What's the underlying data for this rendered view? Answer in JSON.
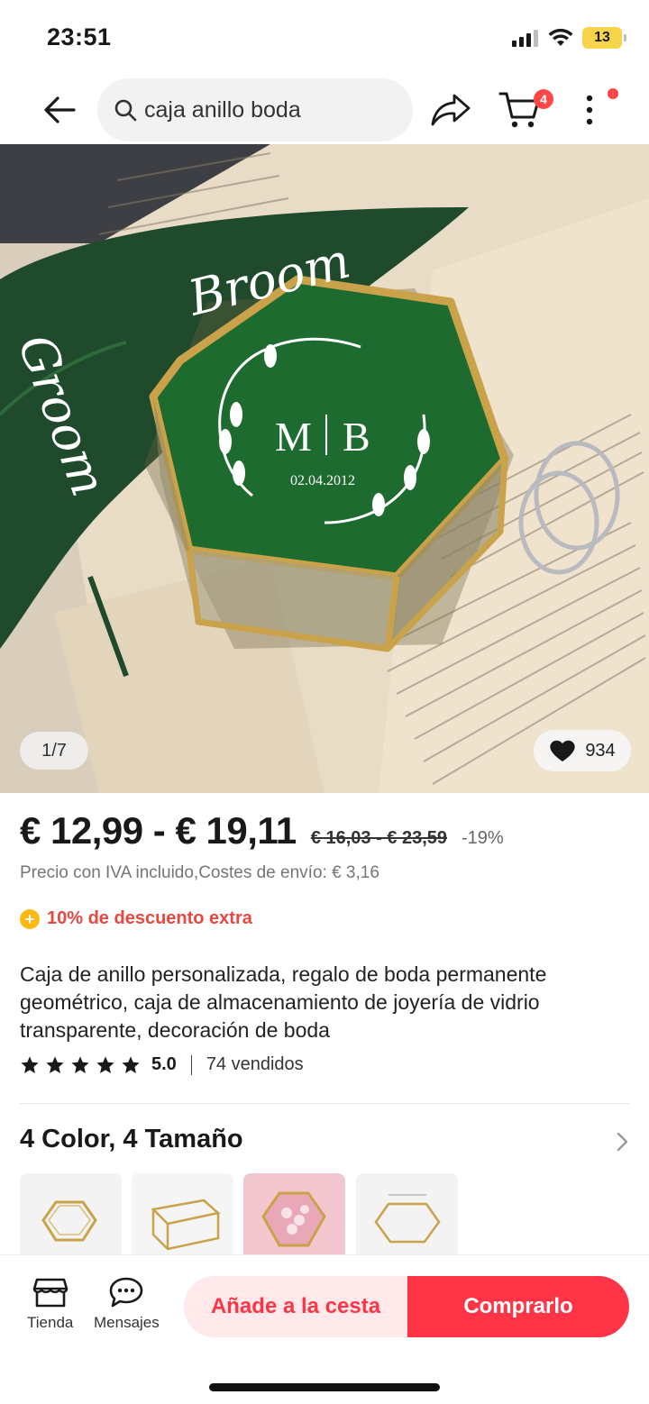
{
  "status_bar": {
    "time": "23:51",
    "battery": "13"
  },
  "search": {
    "query": "caja anillo boda"
  },
  "header": {
    "cart_count": "4"
  },
  "gallery": {
    "position": "1/7",
    "wishlist_count": "934",
    "image_texts": {
      "monogram_left": "M",
      "monogram_right": "B",
      "date": "02.04.2012",
      "script_top": "Broom",
      "script_left": "Groom"
    }
  },
  "product": {
    "price": "€ 12,99 - € 19,11",
    "original_price": "€ 16,03 - € 23,59",
    "discount": "-19%",
    "tax_shipping": "Precio con IVA incluido,Costes de envío: € 3,16",
    "coupon": "10% de descuento extra",
    "title": "Caja de anillo personalizada, regalo de boda permanente geométrico, caja de almacenamiento de joyería de vidrio transparente, decoración de boda",
    "rating": "5.0",
    "rating_stars": 5,
    "sold": "74 vendidos"
  },
  "variants": {
    "title": "4 Color, 4 Tamaño"
  },
  "bottom_bar": {
    "store_label": "Tienda",
    "messages_label": "Mensajes",
    "add_to_cart": "Añade a la cesta",
    "buy_now": "Comprarlo"
  },
  "colors": {
    "accent": "#ff3547",
    "accent_light": "#ffe9ea",
    "coupon": "#e8473f",
    "badge": "#ff4747"
  }
}
